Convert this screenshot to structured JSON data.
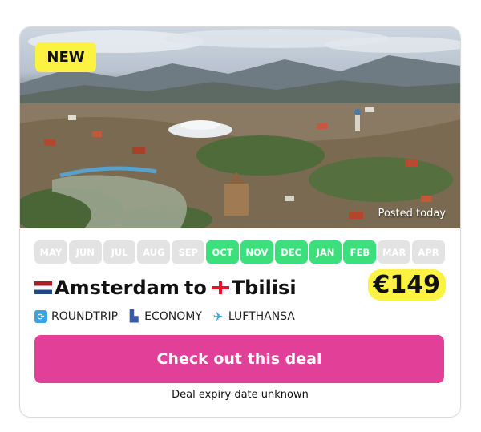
{
  "badge": {
    "label": "NEW"
  },
  "photo": {
    "caption": "Posted today"
  },
  "months": [
    {
      "label": "MAY",
      "active": false
    },
    {
      "label": "JUN",
      "active": false
    },
    {
      "label": "JUL",
      "active": false
    },
    {
      "label": "AUG",
      "active": false
    },
    {
      "label": "SEP",
      "active": false
    },
    {
      "label": "OCT",
      "active": true
    },
    {
      "label": "NOV",
      "active": true
    },
    {
      "label": "DEC",
      "active": true
    },
    {
      "label": "JAN",
      "active": true
    },
    {
      "label": "FEB",
      "active": true
    },
    {
      "label": "MAR",
      "active": false
    },
    {
      "label": "APR",
      "active": false
    }
  ],
  "route": {
    "origin": "Amsterdam",
    "connector": "to",
    "destination": "Tbilisi"
  },
  "price": "€149",
  "meta": {
    "trip_type": "ROUNDTRIP",
    "cabin": "ECONOMY",
    "airline": "LUFTHANSA"
  },
  "cta": {
    "label": "Check out this deal"
  },
  "expiry": "Deal expiry date unknown",
  "colors": {
    "accent": "#e13f98",
    "active_month": "#3dde7c",
    "highlight": "#fcf241"
  }
}
